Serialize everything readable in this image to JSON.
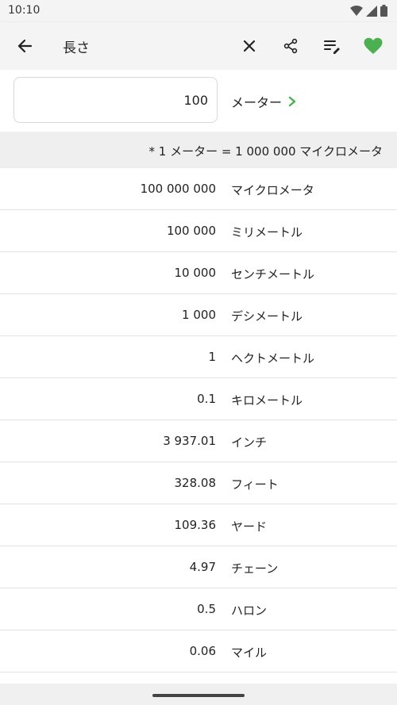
{
  "status_bar": {
    "time": "10:10"
  },
  "app_bar": {
    "title": "長さ",
    "icons": [
      "back-arrow-icon",
      "close-icon",
      "share-icon",
      "playlist-edit-icon",
      "heart-icon"
    ],
    "accent_color": "#4caf50"
  },
  "converter": {
    "input_value": "100",
    "unit": "メーター",
    "formula": "* 1 メーター = 1 000 000 マイクロメータ"
  },
  "results": [
    {
      "value": "100 000 000",
      "unit": "マイクロメータ"
    },
    {
      "value": "100 000",
      "unit": "ミリメートル"
    },
    {
      "value": "10 000",
      "unit": "センチメートル"
    },
    {
      "value": "1 000",
      "unit": "デシメートル"
    },
    {
      "value": "1",
      "unit": "ヘクトメートル"
    },
    {
      "value": "0.1",
      "unit": "キロメートル"
    },
    {
      "value": "3 937.01",
      "unit": "インチ"
    },
    {
      "value": "328.08",
      "unit": "フィート"
    },
    {
      "value": "109.36",
      "unit": "ヤード"
    },
    {
      "value": "4.97",
      "unit": "チェーン"
    },
    {
      "value": "0.5",
      "unit": "ハロン"
    },
    {
      "value": "0.06",
      "unit": "マイル"
    }
  ]
}
